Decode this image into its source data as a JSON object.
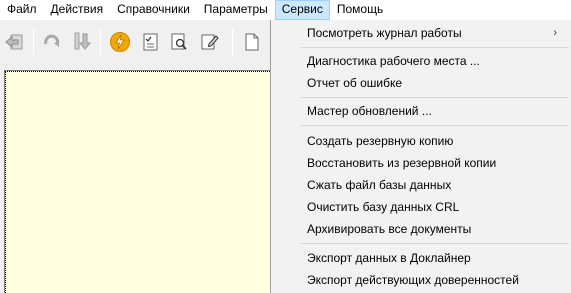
{
  "menubar": {
    "items": [
      "Файл",
      "Действия",
      "Справочники",
      "Параметры",
      "Сервис",
      "Помощь"
    ]
  },
  "toolbar": {
    "icons": [
      "exit-icon",
      "refresh-icon",
      "import-icon",
      "lightning-icon",
      "checklist-icon",
      "search-document-icon",
      "edit-document-icon",
      "new-document-icon"
    ]
  },
  "service_menu": {
    "items": [
      "Посмотреть журнал работы",
      "Диагностика рабочего места ...",
      "Отчет об ошибке",
      "Мастер обновлений ...",
      "Создать резервную копию",
      "Восстановить из резервной копии",
      "Сжать файл базы данных",
      "Очистить базу данных CRL",
      "Архивировать все документы",
      "Экспорт данных в Доклайнер",
      "Экспорт действующих доверенностей"
    ],
    "submenu_arrow": "›"
  },
  "colors": {
    "menu_highlight": "#cce8ff",
    "workarea_bg": "#ffffe1",
    "lightning": "#f5a800"
  }
}
